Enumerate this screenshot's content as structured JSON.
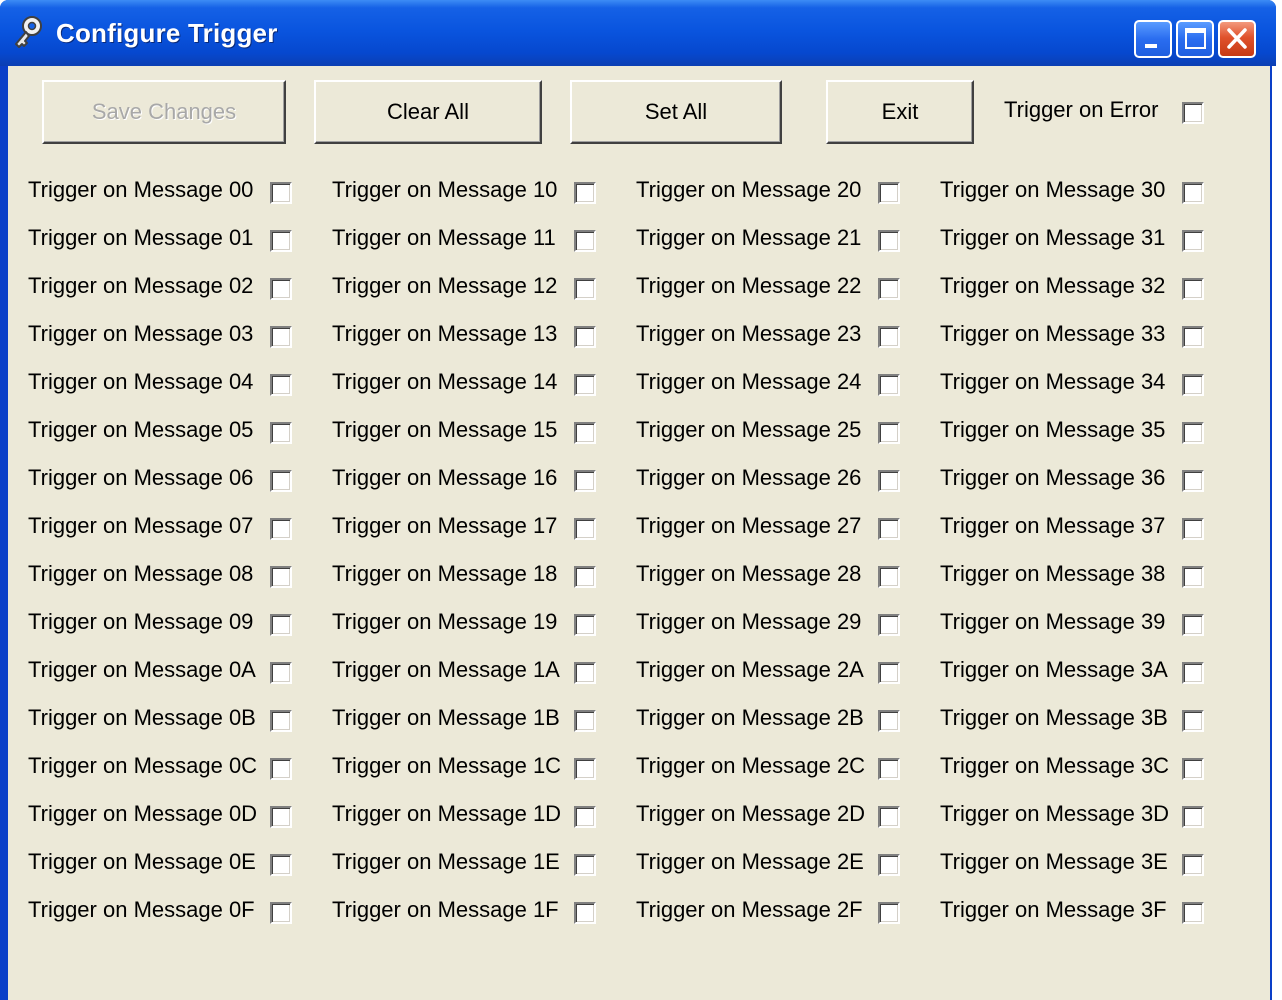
{
  "window": {
    "title": "Configure Trigger",
    "icon": "wrench-key-icon"
  },
  "title_buttons": [
    "minimize-icon",
    "maximize-icon",
    "close-icon"
  ],
  "buttons": {
    "save": {
      "label": "Save Changes",
      "enabled": false
    },
    "clear_all": {
      "label": "Clear All"
    },
    "set_all": {
      "label": "Set All"
    },
    "exit": {
      "label": "Exit"
    }
  },
  "trigger_on_error": {
    "label": "Trigger on Error",
    "checked": false
  },
  "messages": [
    [
      "Trigger on Message 00",
      "Trigger on Message 01",
      "Trigger on Message 02",
      "Trigger on Message 03",
      "Trigger on Message 04",
      "Trigger on Message 05",
      "Trigger on Message 06",
      "Trigger on Message 07",
      "Trigger on Message 08",
      "Trigger on Message 09",
      "Trigger on Message 0A",
      "Trigger on Message 0B",
      "Trigger on Message 0C",
      "Trigger on Message 0D",
      "Trigger on Message 0E",
      "Trigger on Message 0F"
    ],
    [
      "Trigger on Message 10",
      "Trigger on Message 11",
      "Trigger on Message 12",
      "Trigger on Message 13",
      "Trigger on Message 14",
      "Trigger on Message 15",
      "Trigger on Message 16",
      "Trigger on Message 17",
      "Trigger on Message 18",
      "Trigger on Message 19",
      "Trigger on Message 1A",
      "Trigger on Message 1B",
      "Trigger on Message 1C",
      "Trigger on Message 1D",
      "Trigger on Message 1E",
      "Trigger on Message 1F"
    ],
    [
      "Trigger on Message 20",
      "Trigger on Message 21",
      "Trigger on Message 22",
      "Trigger on Message 23",
      "Trigger on Message 24",
      "Trigger on Message 25",
      "Trigger on Message 26",
      "Trigger on Message 27",
      "Trigger on Message 28",
      "Trigger on Message 29",
      "Trigger on Message 2A",
      "Trigger on Message 2B",
      "Trigger on Message 2C",
      "Trigger on Message 2D",
      "Trigger on Message 2E",
      "Trigger on Message 2F"
    ],
    [
      "Trigger on Message 30",
      "Trigger on Message 31",
      "Trigger on Message 32",
      "Trigger on Message 33",
      "Trigger on Message 34",
      "Trigger on Message 35",
      "Trigger on Message 36",
      "Trigger on Message 37",
      "Trigger on Message 38",
      "Trigger on Message 39",
      "Trigger on Message 3A",
      "Trigger on Message 3B",
      "Trigger on Message 3C",
      "Trigger on Message 3D",
      "Trigger on Message 3E",
      "Trigger on Message 3F"
    ]
  ],
  "colors": {
    "titlebar": "#0a55df",
    "dialog_bg": "#ece9d8",
    "disabled_text": "#a8a8a8",
    "close_button": "#e0522c"
  }
}
